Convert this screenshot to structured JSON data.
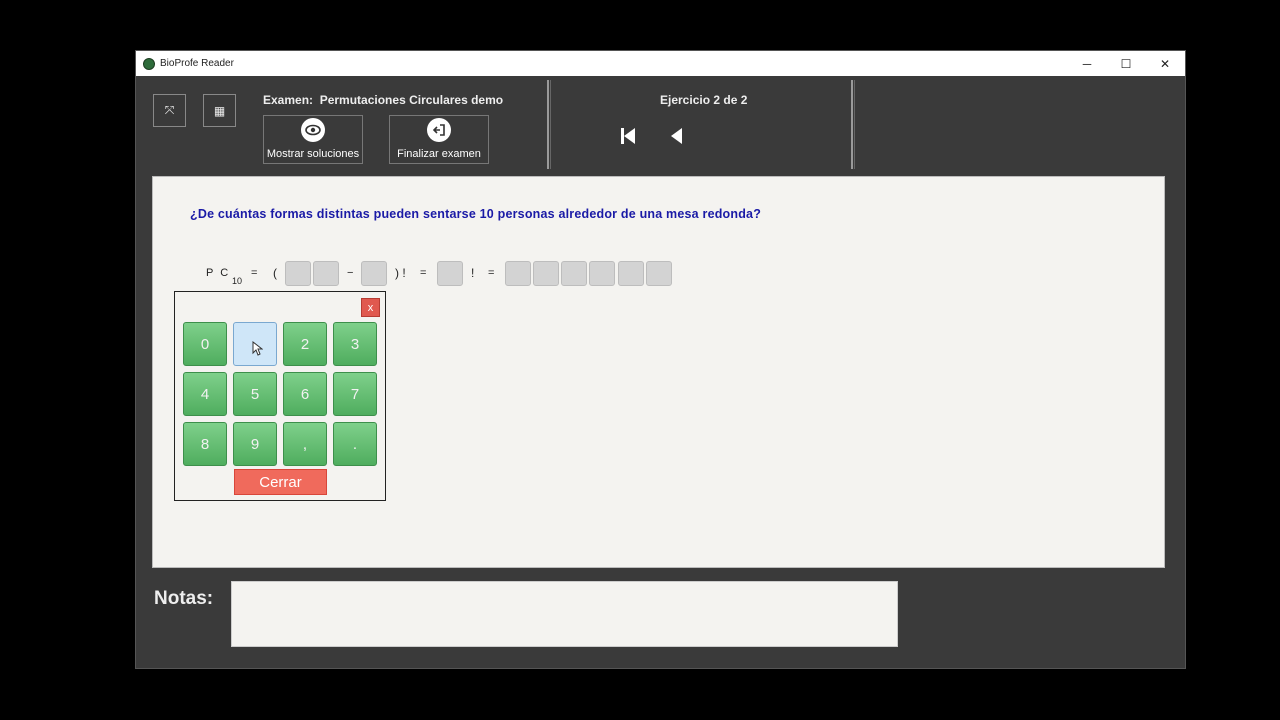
{
  "window": {
    "title": "BioProfe Reader",
    "controls": {
      "minimize": "─",
      "maximize": "☐",
      "close": "✕"
    }
  },
  "toolbar": {
    "expand_icon": "⤧",
    "calculator_icon": "▦",
    "exam_prefix": "Examen:",
    "exam_name": "Permutaciones Circulares demo",
    "show_solutions_label": "Mostrar soluciones",
    "finish_exam_label": "Finalizar examen",
    "exercise_label": "Ejercicio 2 de 2"
  },
  "question": "¿De cuántas formas distintas pueden sentarse 10 personas alrededor de una mesa redonda?",
  "formula": {
    "pc": "P C",
    "subscript": "10",
    "eq1": "=",
    "open_paren": "(",
    "minus": "−",
    "close_fact": ") !",
    "eq2": "=",
    "fact": "!",
    "eq3": "="
  },
  "keypad": {
    "close_label": "x",
    "keys": [
      "0",
      "1",
      "2",
      "3",
      "4",
      "5",
      "6",
      "7",
      "8",
      "9",
      ",",
      "."
    ],
    "hovered_key": "1",
    "cerrar_label": "Cerrar"
  },
  "notes": {
    "label": "Notas:",
    "value": ""
  },
  "colors": {
    "question": "#1a1aa6",
    "key_green": "#5fbd6e",
    "close_red": "#f06a5c"
  }
}
